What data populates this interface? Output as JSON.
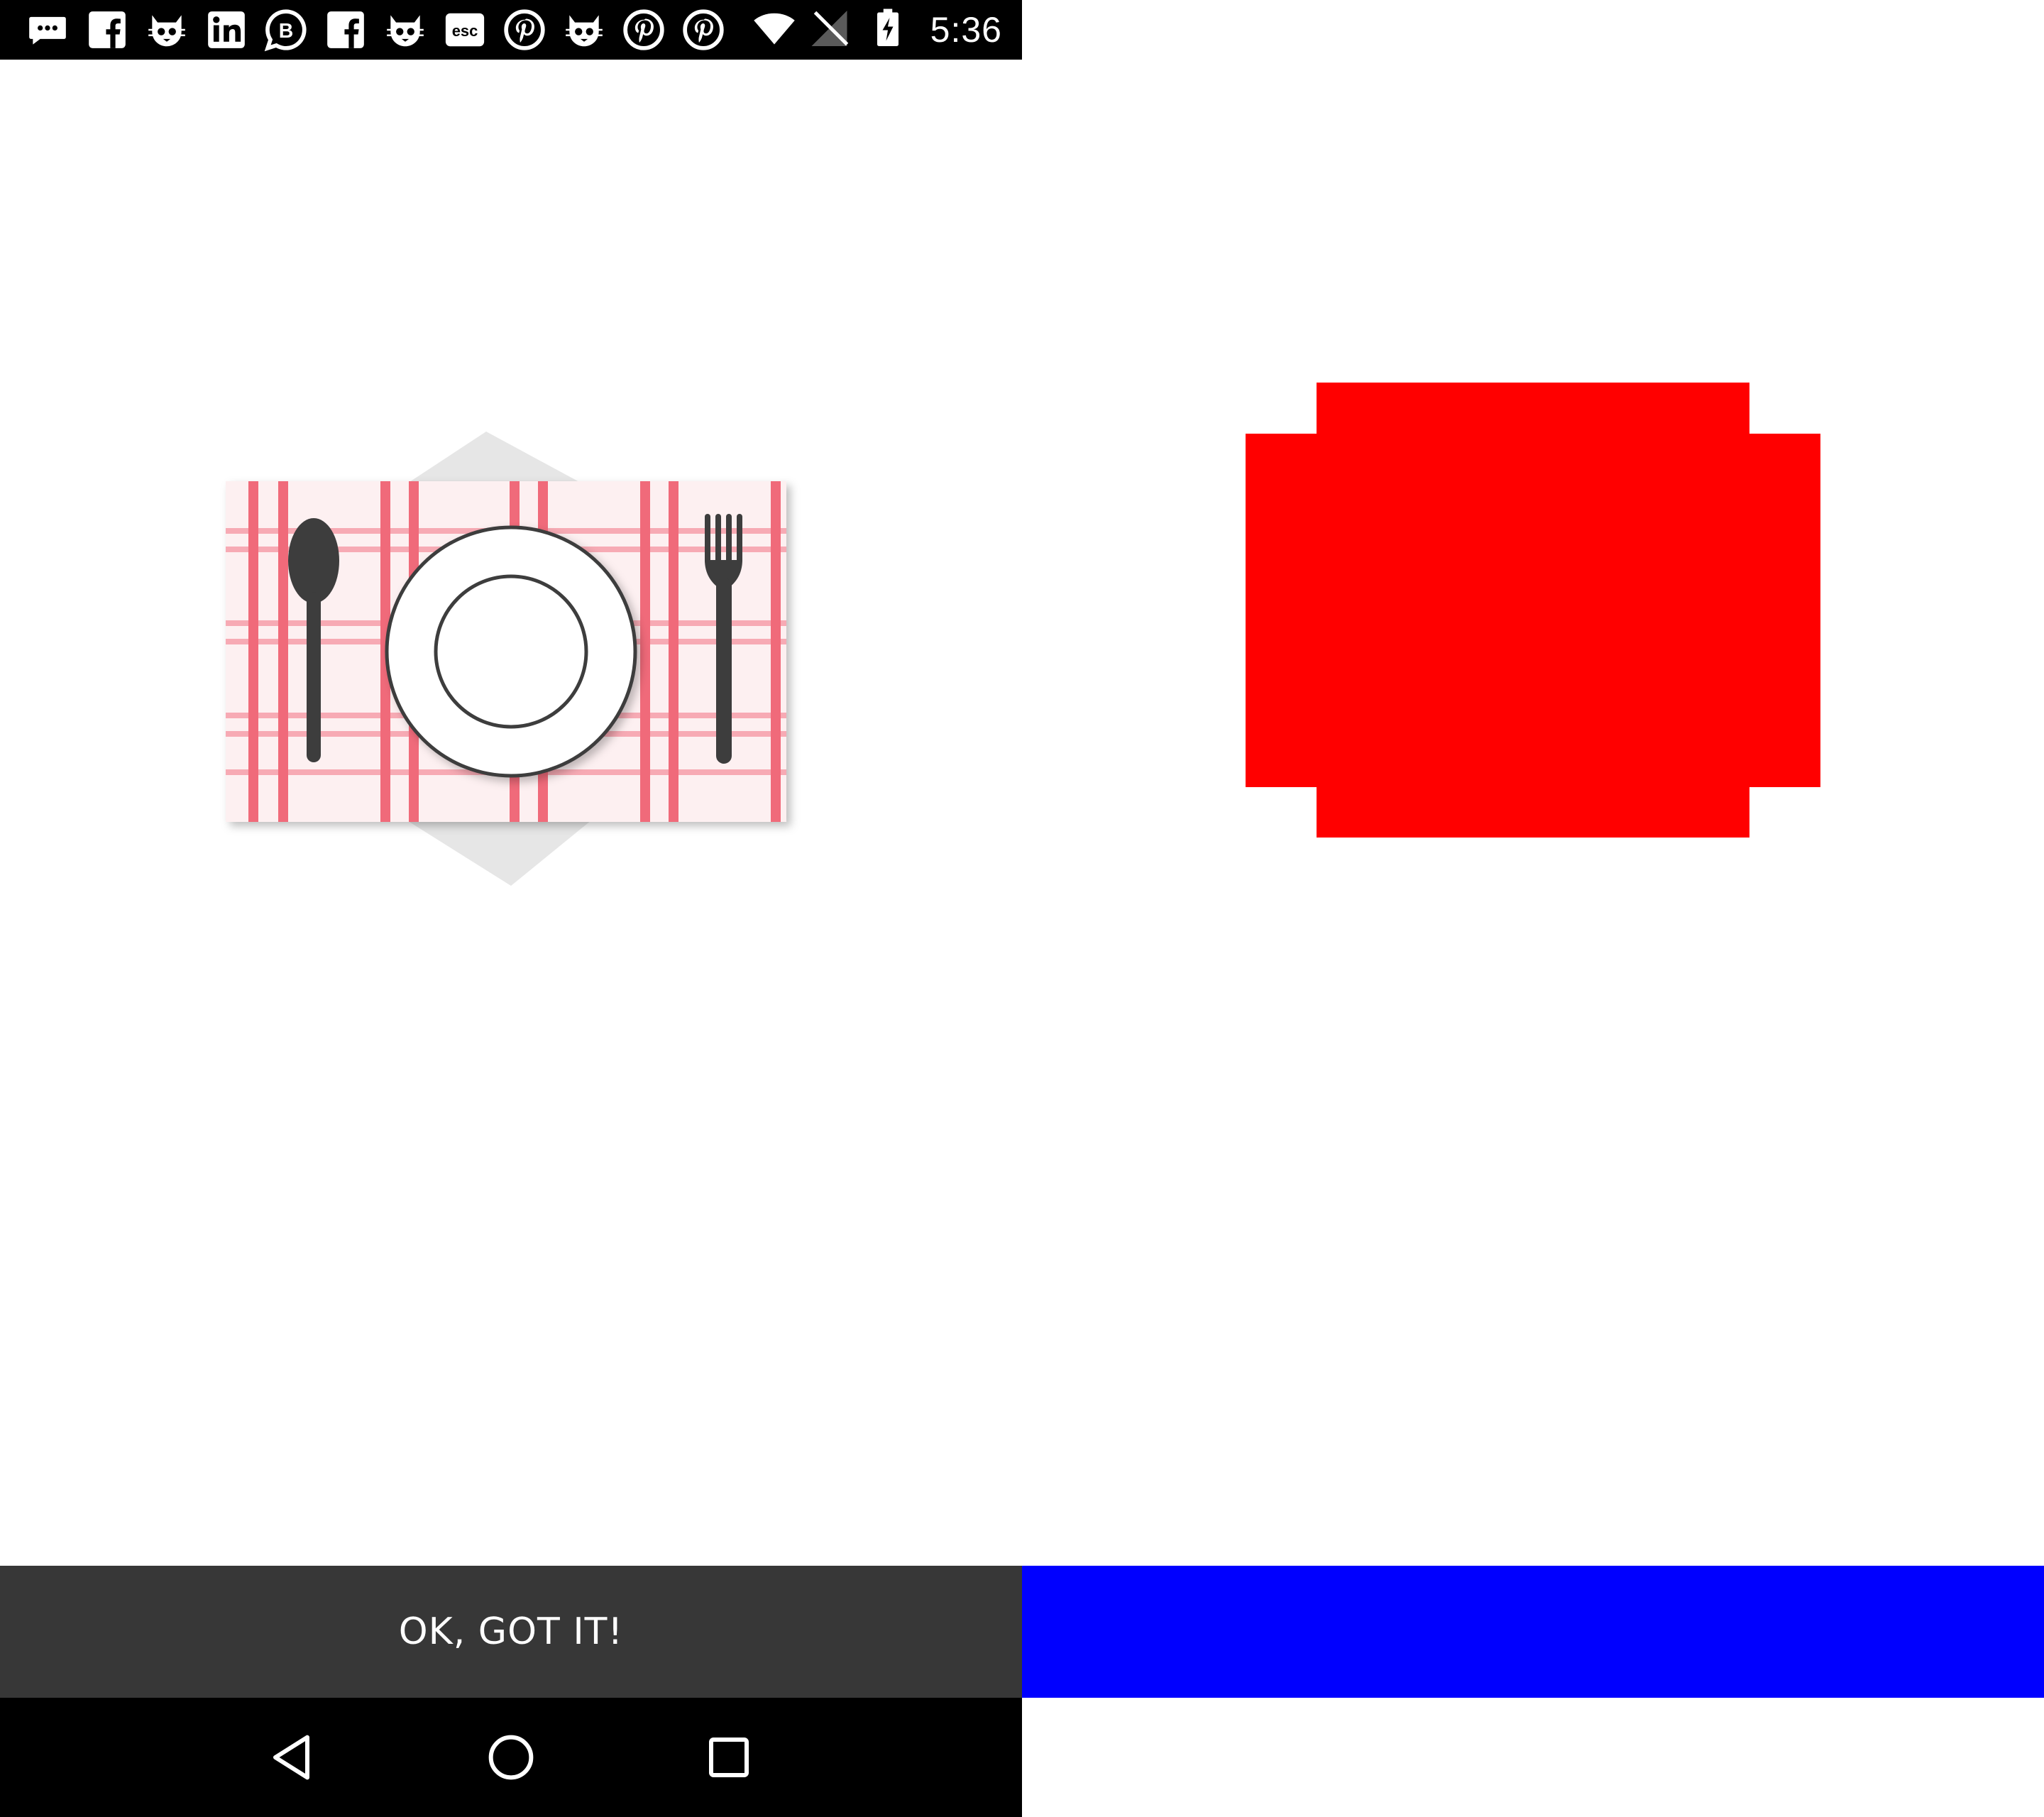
{
  "status_bar": {
    "notification_icons": [
      "messages-icon",
      "facebook-icon",
      "cat-app-icon",
      "linkedin-icon",
      "b-chat-icon",
      "facebook-icon",
      "cat-app-icon",
      "esc-icon",
      "pinterest-icon",
      "cat-app-icon",
      "pinterest-icon",
      "pinterest-icon"
    ],
    "esc_text": "esc",
    "b_text": "B",
    "system_icons": [
      "wifi-icon",
      "no-sim-icon",
      "battery-charging-icon"
    ],
    "time": "5:36"
  },
  "illustration": {
    "name": "place-setting",
    "tablecloth_color": "#f06a7a",
    "plate_color": "#ffffff",
    "cutlery_color": "#3d3d3d"
  },
  "footer": {
    "ok_label": "OK, GOT IT!",
    "background": "#373737"
  },
  "navigation": {
    "buttons": [
      "back-icon",
      "home-icon",
      "recents-icon"
    ]
  },
  "annotation_panel": {
    "highlight_colors": {
      "image_region": "#ff0000",
      "button_region": "#0000ff"
    }
  }
}
